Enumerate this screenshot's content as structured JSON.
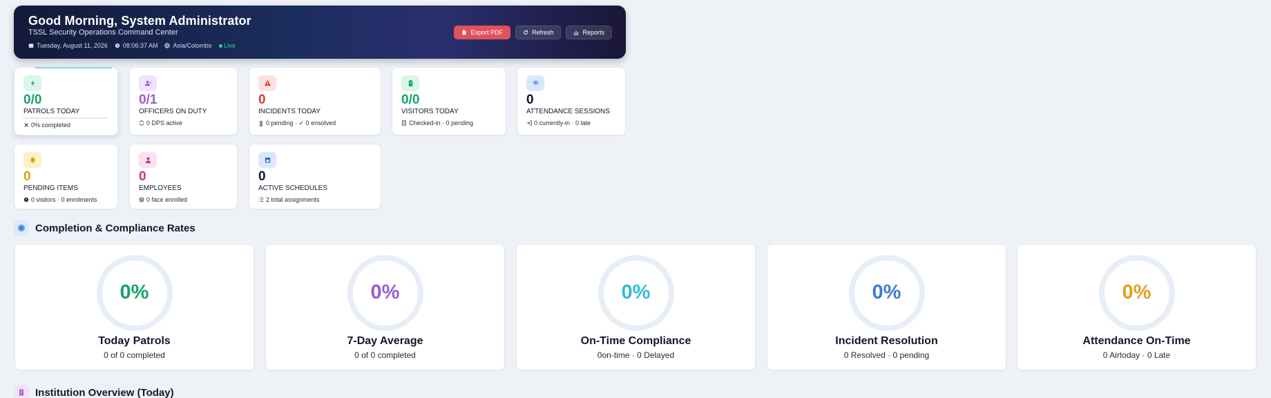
{
  "header": {
    "greeting": "Good Morning, System Administrator",
    "subtitle": "TSSL Security Operations Command Center",
    "date": "Tuesday, August 11, 2026",
    "time": "08:06:37 AM",
    "timezone": "Asia/Colombo",
    "live_label": "Live",
    "actions": {
      "export_pdf": "Export PDF",
      "refresh": "Refresh",
      "reports": "Reports"
    }
  },
  "stats": [
    {
      "value": "0/0",
      "label": "PATROLS TODAY",
      "foot": "0% completed",
      "icon": "bolt-icon",
      "color": "#16a36a",
      "bg": "#d9f6e8",
      "progress": 0
    },
    {
      "value": "0/1",
      "label": "OFFICERS ON DUTY",
      "foot": "0 DPS active",
      "icon": "user-check-icon",
      "color": "#9b59d0",
      "bg": "#efe3fb"
    },
    {
      "value": "0",
      "label": "INCIDENTS TODAY",
      "foot": "0 pending · ✓ 0 ensolved",
      "icon": "warning-icon",
      "color": "#dc3b3b",
      "bg": "#fde0e0"
    },
    {
      "value": "0/0",
      "label": "VISITORS TODAY",
      "foot": "Checked-in · 0 pending",
      "icon": "badge-icon",
      "color": "#16a36a",
      "bg": "#d9f6e8"
    },
    {
      "value": "0",
      "label": "ATTENDANCE SESSIONS",
      "foot": "0 currently-in · 0 late",
      "icon": "fingerprint-icon",
      "color": "#0f172a",
      "bg": "#dbe8fb"
    },
    {
      "value": "0",
      "label": "PENDING ITEMS",
      "foot": "0 visitors · 0 enrolments",
      "icon": "bell-icon",
      "color": "#e0a00a",
      "bg": "#fdf1c7"
    },
    {
      "value": "0",
      "label": "EMPLOYEES",
      "foot": "0 face enrolled",
      "icon": "person-icon",
      "color": "#c2338a",
      "bg": "#fbe0ef"
    },
    {
      "value": "0",
      "label": "ACTIVE SCHEDULES",
      "foot": "2 total assignments",
      "icon": "calendar-icon",
      "color": "#0f172a",
      "bg": "#dbe8fb"
    }
  ],
  "compliance": {
    "title": "Completion & Compliance Rates",
    "cards": [
      {
        "percent": "0%",
        "title": "Today Patrols",
        "sub": "0 of 0 completed",
        "color": "#16a36a"
      },
      {
        "percent": "0%",
        "title": "7-Day Average",
        "sub": "0 of 0 completed",
        "color": "#9b5bd6"
      },
      {
        "percent": "0%",
        "title": "On-Time Compliance",
        "sub": "0on-time · 0 Delayed",
        "color": "#2fbcd3"
      },
      {
        "percent": "0%",
        "title": "Incident Resolution",
        "sub": "0 Resolved · 0 pending",
        "color": "#3f7bd1"
      },
      {
        "percent": "0%",
        "title": "Attendance On-Time",
        "sub": "0 Airtoday · 0 Late",
        "color": "#e0a020"
      }
    ]
  },
  "institution": {
    "title": "Institution Overview (Today)"
  }
}
